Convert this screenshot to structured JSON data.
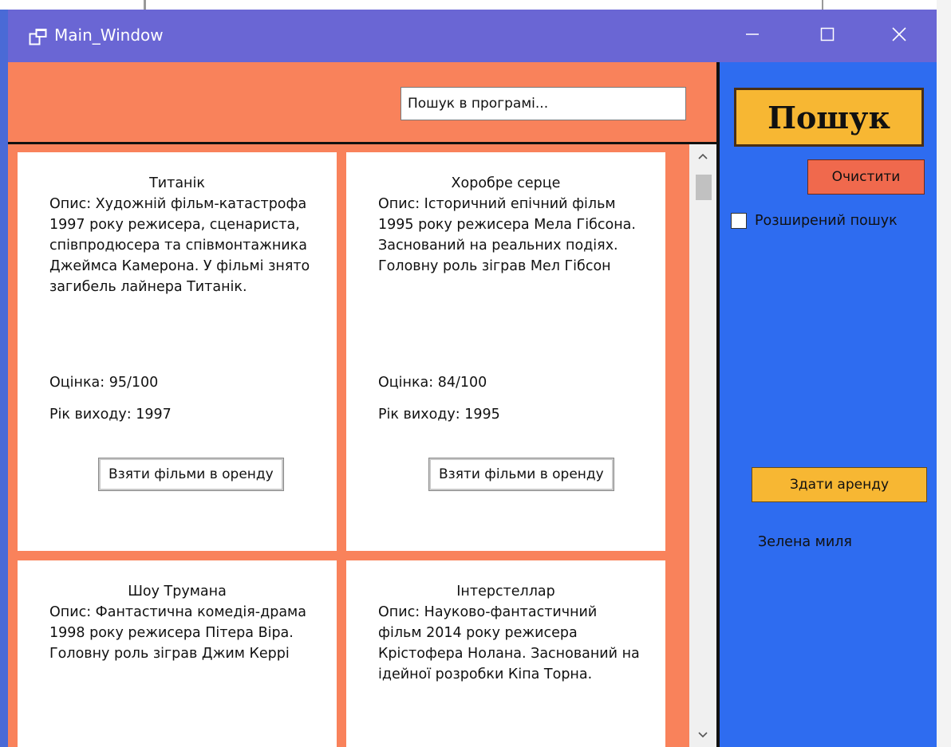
{
  "window": {
    "title": "Main_Window"
  },
  "colors": {
    "titlebar": "#6a66d4",
    "left_pane": "#f9825b",
    "right_pane": "#2e6cf0",
    "search_button": "#f7b733",
    "clear_button": "#f0694d"
  },
  "header": {
    "search_placeholder": "Пошук в програмі..."
  },
  "films": [
    {
      "title": "Титанік",
      "description": "Опис: Художній фільм-катастрофа 1997 року режисера, сценариста, співпродюсера та співмонтажника Джеймса Камерона. У фільмі знято загибель лайнера Титанік.",
      "rating": "Оцінка: 95/100",
      "year": "Рік виходу: 1997",
      "rent_label": "Взяти фільми в оренду"
    },
    {
      "title": "Хоробре серце",
      "description": "Опис: Історичний епічний фільм 1995 року режисера Мела Гібсона. Заснований на реальних подіях. Головну роль зіграв Мел Гібсон",
      "rating": "Оцінка: 84/100",
      "year": "Рік виходу: 1995",
      "rent_label": "Взяти фільми в оренду"
    },
    {
      "title": "Шоу Трумана",
      "description": "Опис: Фантастична комедія-драма 1998 року режисера Пітера Віра. Головну роль зіграв Джим Керрі"
    },
    {
      "title": "Інтерстеллар",
      "description": "Опис: Науково-фантастичний фільм 2014 року режисера Крістофера Нолана. Заснований на ідейної розробки Кіпа Торна."
    }
  ],
  "sidebar": {
    "search_label": "Пошук",
    "clear_label": "Очистити",
    "advanced_label": "Розширений пошук",
    "return_label": "Здати аренду",
    "rented_film": "Зелена миля"
  },
  "icons": {
    "app": "window-restore-icon",
    "minimize": "minimize-icon",
    "maximize": "maximize-icon",
    "close": "close-icon",
    "scroll_up": "chevron-up-icon",
    "scroll_down": "chevron-down-icon"
  }
}
